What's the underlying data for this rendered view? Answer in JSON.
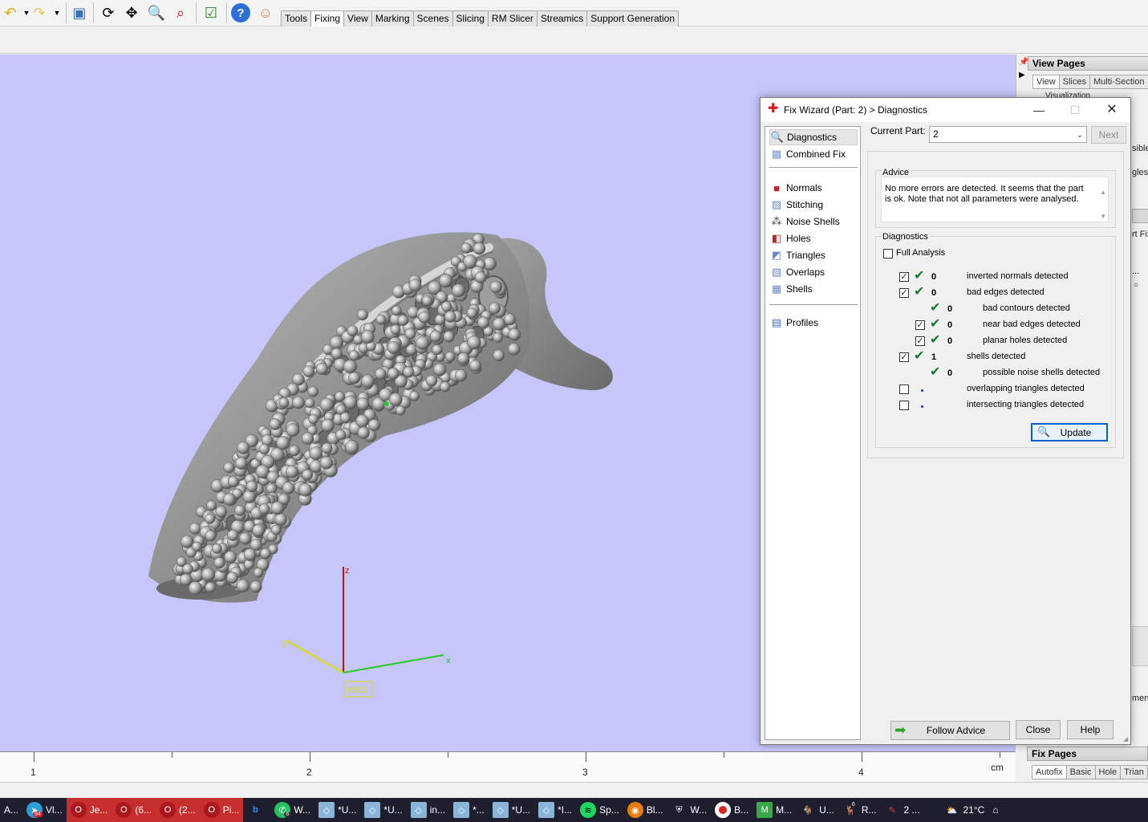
{
  "toolbar": {
    "tabs": [
      "Tools",
      "Fixing",
      "View",
      "Marking",
      "Scenes",
      "Slicing",
      "RM Slicer",
      "Streamics",
      "Support Generation"
    ],
    "active_tab": "Fixing"
  },
  "viewport": {
    "axis_z": "z",
    "axis_x": "x",
    "axis_y": "y",
    "wcs_label": "WCS"
  },
  "right_panel": {
    "view_pages_title": "View Pages",
    "view_tabs": [
      "View",
      "Slices",
      "Multi-Section"
    ],
    "fragment_visualization": "Visualization",
    "fragment_sible": "sible",
    "fragment_gles": "gles V",
    "fragment_rtfix": "rt Fix",
    "fragment_ellipsis": "...",
    "fragment_ment": "ment",
    "fix_pages_title": "Fix Pages",
    "fix_tabs": [
      "Autofix",
      "Basic",
      "Hole",
      "Trian"
    ]
  },
  "ruler": {
    "labels": [
      "1",
      "2",
      "3",
      "4"
    ],
    "unit": "cm"
  },
  "dialog": {
    "title": "Fix Wizard (Part: 2) > Diagnostics",
    "nav": {
      "top": [
        "Diagnostics",
        "Combined Fix"
      ],
      "middle": [
        "Normals",
        "Stitching",
        "Noise Shells",
        "Holes",
        "Triangles",
        "Overlaps",
        "Shells"
      ],
      "bottom": [
        "Profiles"
      ],
      "selected": "Diagnostics"
    },
    "current_part_label": "Current Part:",
    "current_part_value": "2",
    "next_button": "Next",
    "advice_label": "Advice",
    "advice_text": "No more errors are detected. It seems that the part is ok. Note that not all parameters were analysed.",
    "diagnostics_label": "Diagnostics",
    "full_analysis_label": "Full Analysis",
    "rows": [
      {
        "count": "0",
        "label": "inverted normals detected"
      },
      {
        "count": "0",
        "label": "bad edges detected"
      },
      {
        "count": "0",
        "label": "bad contours detected"
      },
      {
        "count": "0",
        "label": "near bad edges detected"
      },
      {
        "count": "0",
        "label": "planar holes detected"
      },
      {
        "count": "1",
        "label": "shells detected"
      },
      {
        "count": "0",
        "label": "possible noise shells detected"
      },
      {
        "count": "",
        "label": "overlapping triangles detected"
      },
      {
        "count": "",
        "label": "intersecting triangles detected"
      }
    ],
    "update_button": "Update",
    "follow_advice_button": "Follow Advice",
    "close_button": "Close",
    "help_button": "Help"
  },
  "taskbar": {
    "items": [
      "A...",
      "Vl...",
      "Je...",
      "(6...",
      "(2...",
      "Pi...",
      "W...",
      "*U...",
      "*U...",
      "in...",
      "*...",
      "*U...",
      "*I...",
      "Sp...",
      "Bl...",
      "W...",
      "B...",
      "M...",
      "U...",
      "R...",
      "2 ..."
    ],
    "badge_94": "94",
    "badge_6a": "6",
    "badge_6b": "6",
    "temperature": "21°C"
  },
  "colors": {
    "viewport_bg": "#c6c6fa",
    "axis_z": "#cc1111",
    "axis_x": "#22cc22",
    "axis_y": "#dddd00",
    "check_green": "#1a7a2a"
  }
}
